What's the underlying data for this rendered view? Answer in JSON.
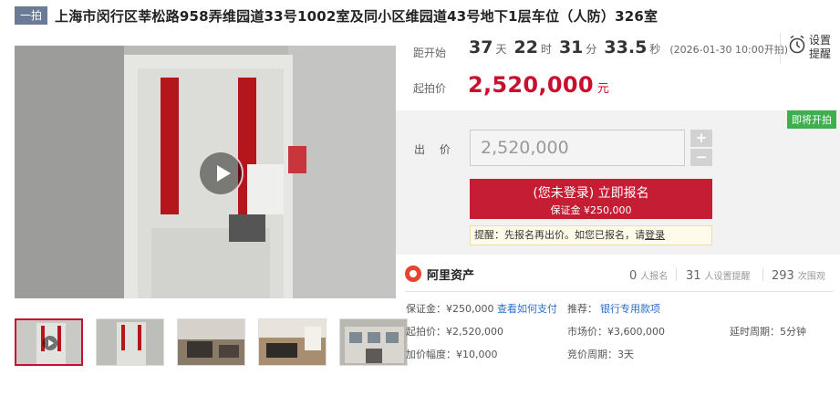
{
  "header": {
    "tag": "一拍",
    "title": "上海市闵行区莘松路958弄维园道33号1002室及同小区维园道43号地下1层车位（人防）326室"
  },
  "countdown": {
    "label": "距开始",
    "days": "37",
    "days_unit": "天",
    "hours": "22",
    "hours_unit": "时",
    "minutes": "31",
    "minutes_unit": "分",
    "seconds": "33.5",
    "seconds_unit": "秒",
    "start_time": "(2026-01-30 10:00开拍)"
  },
  "reminder": {
    "icon": "alarm-clock-icon",
    "label": "设置提醒"
  },
  "start_price": {
    "label": "起拍价",
    "value": "2,520,000",
    "unit": "元"
  },
  "bid": {
    "badge": "即将开拍",
    "label": "出 价",
    "input_value": "2,520,000",
    "plus": "+",
    "minus": "−",
    "signup_main": "(您未登录) 立即报名",
    "signup_sub": "保证金 ¥250,000",
    "tip_prefix": "提醒：先报名再出价。如您已报名，请",
    "tip_link": "登录"
  },
  "brand": {
    "name": "阿里资产",
    "logo_icon": "ali-asset-logo-icon",
    "signups": "0",
    "signups_label": "人报名",
    "reminders": "31",
    "reminders_label": "人设置提醒",
    "views": "293",
    "views_label": "次围观"
  },
  "info": {
    "deposit": "保证金：¥250,000",
    "payment_link": "查看如何支付",
    "recommend_label": "推荐：",
    "recommend_link": "银行专用款项",
    "start_price": "起拍价：¥2,520,000",
    "market_price": "市场价：¥3,600,000",
    "delay": "延时周期：5分钟",
    "increment": "加价幅度：¥10,000",
    "cycle": "竞价周期：3天"
  },
  "colors": {
    "accent": "#c51d34",
    "price": "#c8102e",
    "badge_green": "#3daf4f",
    "tag_bg": "#6c7b95",
    "link": "#2a6fc9"
  }
}
